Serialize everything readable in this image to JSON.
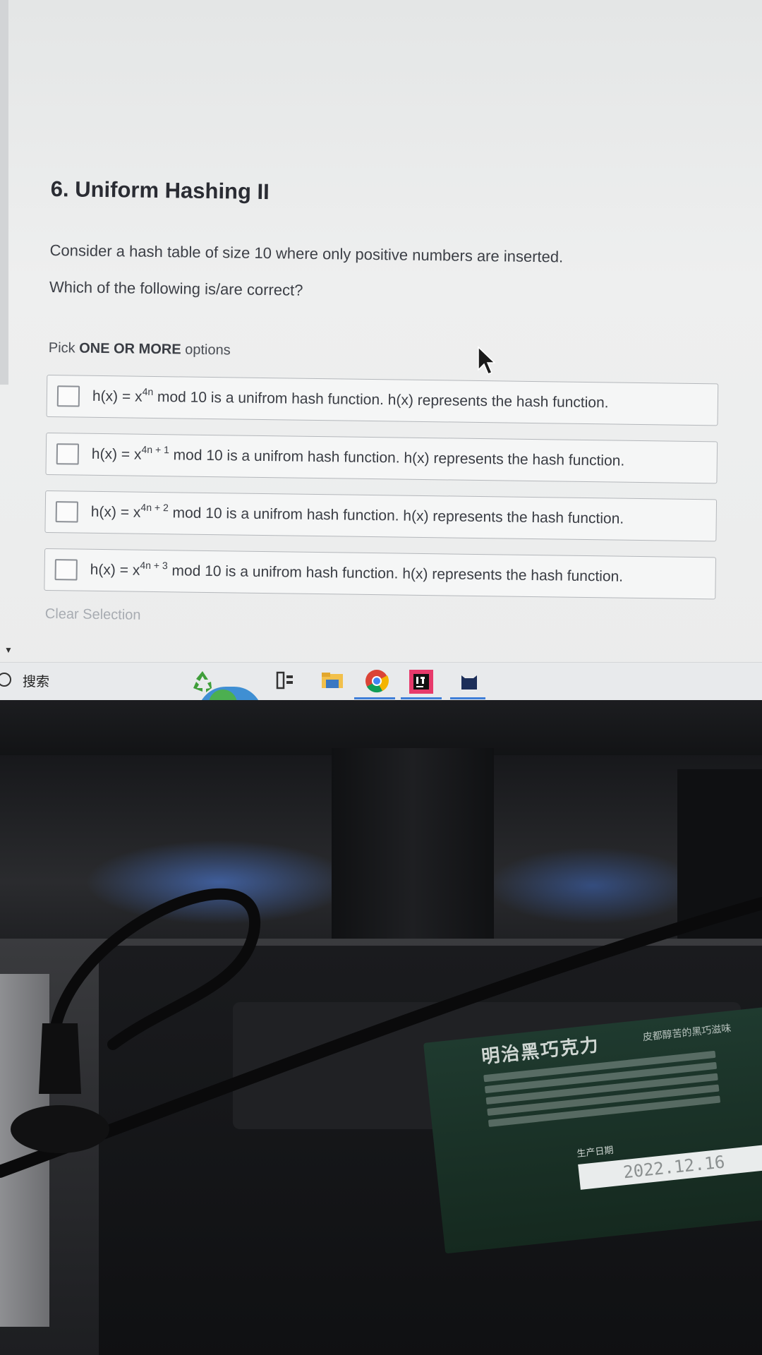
{
  "question": {
    "title": "6. Uniform Hashing II",
    "line1": "Consider a hash table of size 10 where only positive numbers are inserted.",
    "line2": "Which of the following is/are correct?",
    "pick_prefix": "Pick",
    "pick_bold": "ONE OR MORE",
    "pick_suffix": "options",
    "options": [
      {
        "prefix": "h(x) = x",
        "exponent": "4n",
        "suffix": "mod 10 is a unifrom hash function. h(x) represents the hash function.",
        "checked": false
      },
      {
        "prefix": "h(x) = x",
        "exponent": "4n + 1",
        "suffix": "mod 10 is a unifrom hash function. h(x) represents the hash function.",
        "checked": false
      },
      {
        "prefix": "h(x) = x",
        "exponent": "4n + 2",
        "suffix": "mod 10 is a unifrom hash function. h(x) represents the hash function.",
        "checked": false
      },
      {
        "prefix": "h(x) = x",
        "exponent": "4n + 3",
        "suffix": "mod 10 is a unifrom hash function. h(x) represents the hash function.",
        "checked": false
      }
    ],
    "clear_label": "Clear Selection"
  },
  "taskbar": {
    "search_label": "搜索",
    "icons": [
      "recycle-icon",
      "task-view-icon",
      "file-explorer-icon",
      "chrome-icon",
      "intellij-icon",
      "cat-app-icon"
    ],
    "accent": "#3f7fd8"
  },
  "scene": {
    "package_brand": "明治黑巧克力",
    "package_slogan": "皮都醇苦的黑巧滋味",
    "package_date_label": "生产日期",
    "package_date": "2022.12.16"
  }
}
